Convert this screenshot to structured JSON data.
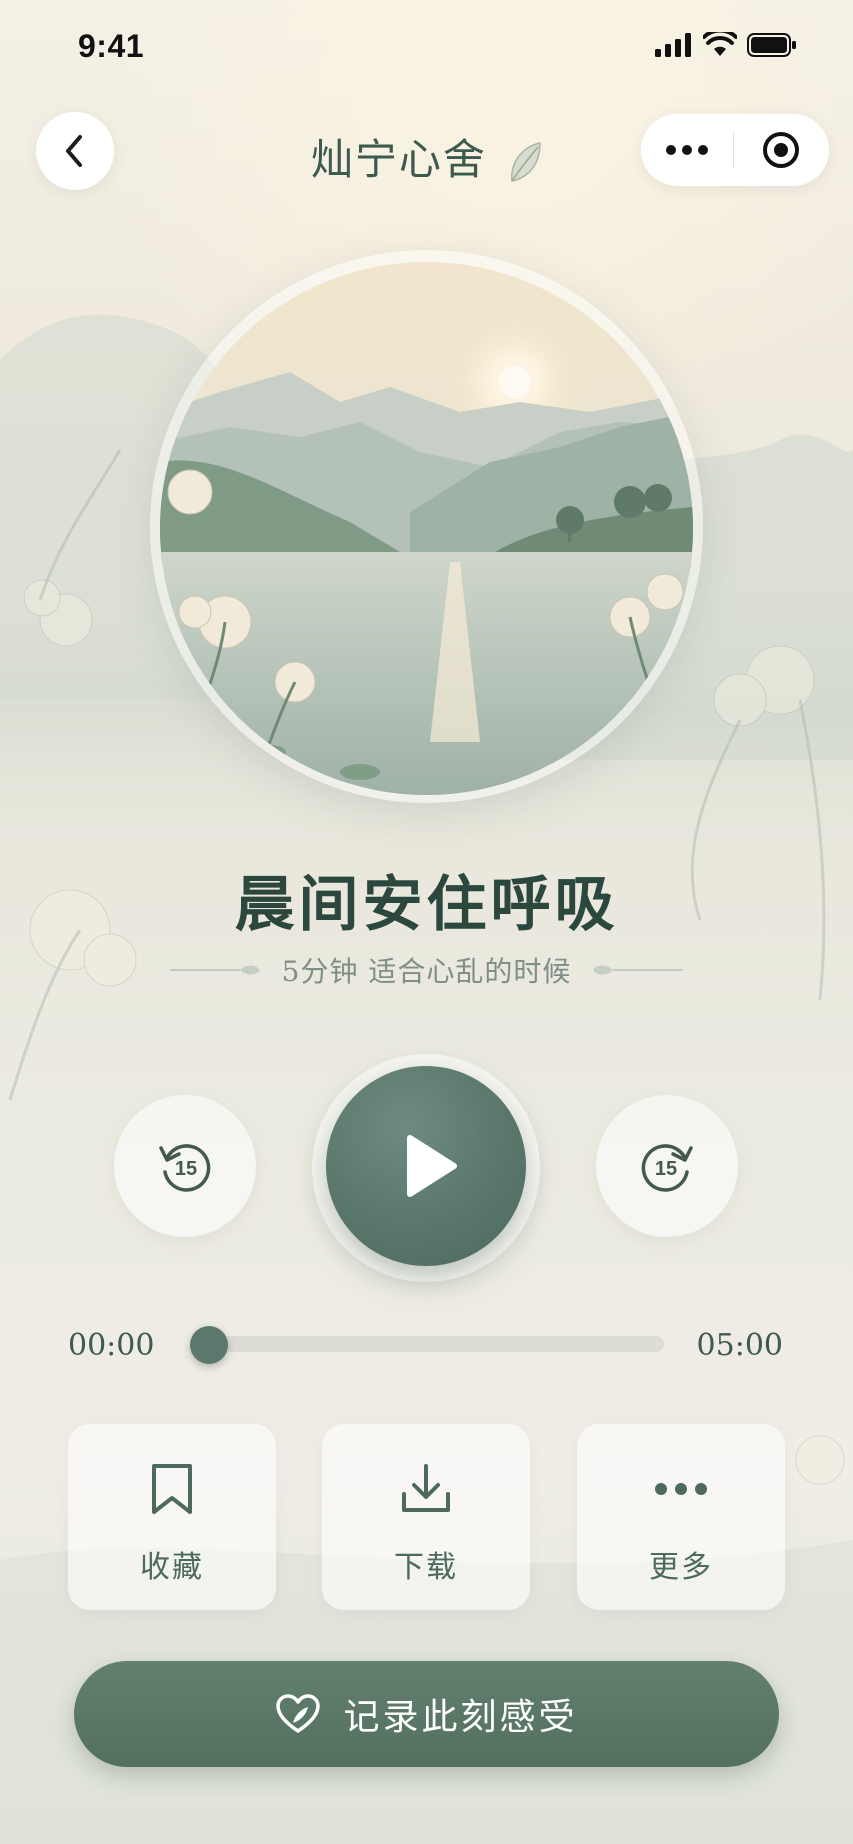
{
  "status_bar": {
    "time": "9:41"
  },
  "nav": {
    "title": "灿宁心舍"
  },
  "track": {
    "title": "晨间安住呼吸",
    "subtitle": "5分钟  适合心乱的时候"
  },
  "controls": {
    "rewind_seconds": "15",
    "forward_seconds": "15"
  },
  "progress": {
    "current": "00:00",
    "total": "05:00",
    "fraction": 0.0
  },
  "actions": [
    {
      "label": "收藏",
      "icon": "bookmark-icon"
    },
    {
      "label": "下载",
      "icon": "download-icon"
    },
    {
      "label": "更多",
      "icon": "more-dots-icon"
    }
  ],
  "cta": {
    "label": "记录此刻感受",
    "icon": "heart-leaf-icon"
  },
  "colors": {
    "accent": "#58756a",
    "text_dark": "#2c473d",
    "text_muted": "#7f8e86"
  }
}
